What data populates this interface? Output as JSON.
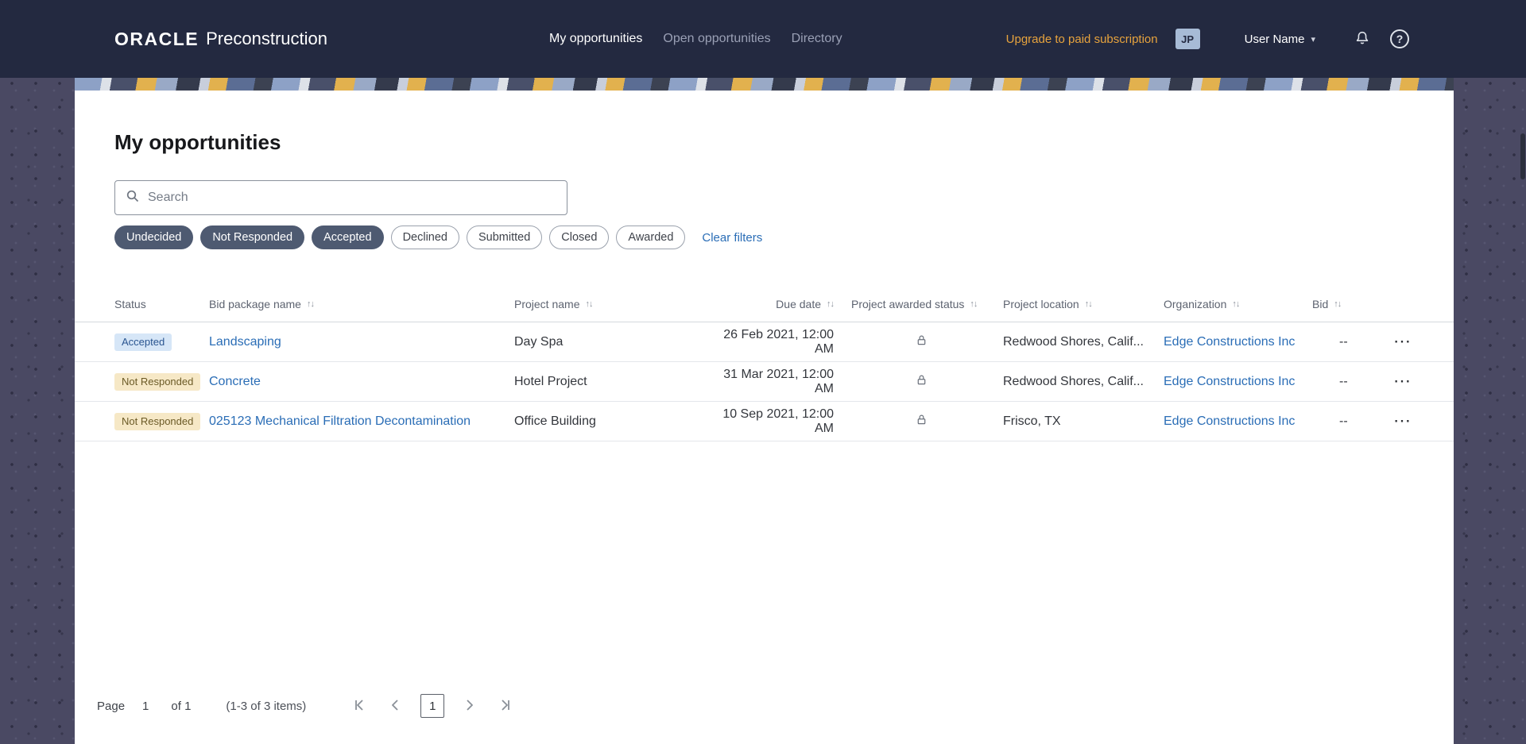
{
  "header": {
    "brand_primary": "ORACLE",
    "brand_secondary": "Preconstruction",
    "nav": [
      {
        "label": "My opportunities",
        "active": true
      },
      {
        "label": "Open opportunities",
        "active": false
      },
      {
        "label": "Directory",
        "active": false
      }
    ],
    "upgrade_link": "Upgrade to paid subscription",
    "avatar_initials": "JP",
    "user_name": "User Name"
  },
  "page": {
    "title": "My opportunities",
    "search_placeholder": "Search",
    "filter_chips": [
      {
        "label": "Undecided",
        "selected": true
      },
      {
        "label": "Not Responded",
        "selected": true
      },
      {
        "label": "Accepted",
        "selected": true
      },
      {
        "label": "Declined",
        "selected": false
      },
      {
        "label": "Submitted",
        "selected": false
      },
      {
        "label": "Closed",
        "selected": false
      },
      {
        "label": "Awarded",
        "selected": false
      }
    ],
    "clear_filters": "Clear filters"
  },
  "table": {
    "columns": [
      {
        "label": "Status",
        "sortable": false
      },
      {
        "label": "Bid package name",
        "sortable": true
      },
      {
        "label": "Project name",
        "sortable": true
      },
      {
        "label": "Due date",
        "sortable": true
      },
      {
        "label": "Project awarded status",
        "sortable": true
      },
      {
        "label": "Project location",
        "sortable": true
      },
      {
        "label": "Organization",
        "sortable": true
      },
      {
        "label": "Bid",
        "sortable": true
      }
    ],
    "rows": [
      {
        "status": "Accepted",
        "bid_package_name": "Landscaping",
        "project_name": "Day Spa",
        "due_date": "26 Feb 2021, 12:00 AM",
        "project_awarded_status": "lock-icon",
        "project_location": "Redwood Shores, Calif...",
        "organization": "Edge Constructions Inc",
        "bid": "--"
      },
      {
        "status": "Not Responded",
        "bid_package_name": "Concrete",
        "project_name": "Hotel Project",
        "due_date": "31 Mar 2021, 12:00 AM",
        "project_awarded_status": "lock-icon",
        "project_location": "Redwood Shores, Calif...",
        "organization": "Edge Constructions Inc",
        "bid": "--"
      },
      {
        "status": "Not Responded",
        "bid_package_name": "025123 Mechanical Filtration Decontamination",
        "project_name": "Office Building",
        "due_date": "10 Sep 2021, 12:00 AM",
        "project_awarded_status": "lock-icon",
        "project_location": "Frisco, TX",
        "organization": "Edge Constructions Inc",
        "bid": "--"
      }
    ]
  },
  "pagination": {
    "page_label": "Page",
    "page_value": "1",
    "of_label": "of 1",
    "items_summary": "(1-3 of 3 items)",
    "current_page_button": "1"
  },
  "icons": {
    "sort": "↑↓",
    "row_menu": "⋯",
    "help": "?",
    "caret_down": "▾"
  },
  "colors": {
    "header_bg": "#232940",
    "page_bg": "#4a4963",
    "link": "#2a6db6",
    "upgrade_gold": "#e7a33d",
    "chip_selected_bg": "#4e5a71",
    "badge_accepted_bg": "#d6e6f7",
    "badge_accepted_text": "#2a5590",
    "badge_not_responded_bg": "#f6e8c6",
    "badge_not_responded_text": "#6b5a26"
  }
}
